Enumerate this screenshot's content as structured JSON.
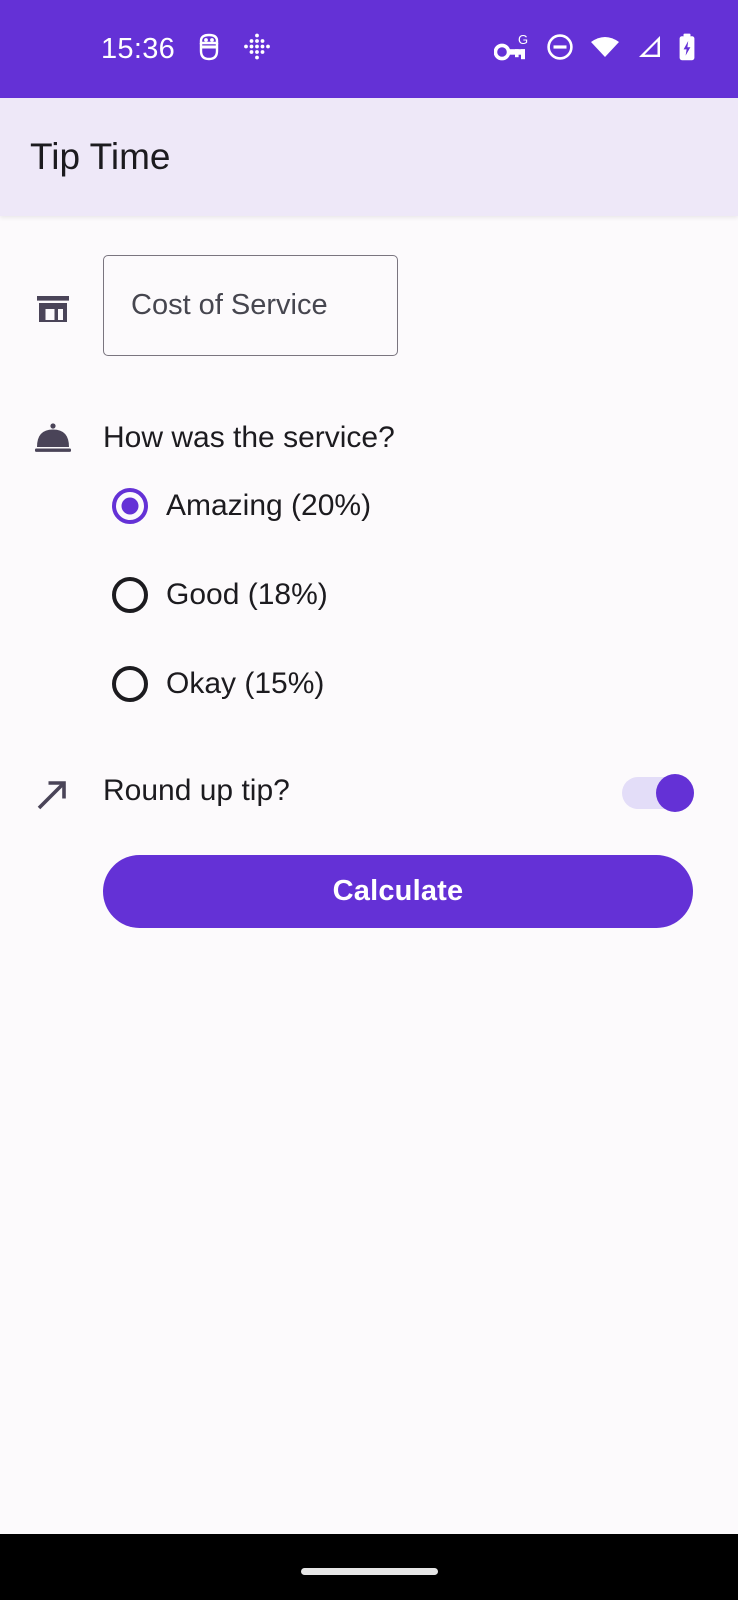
{
  "status_bar": {
    "clock": "15:36",
    "background_color": "#6431D6",
    "left_icons": [
      {
        "name": "android-debug-icon",
        "label": "USB debugging"
      },
      {
        "name": "dotted-diamond-icon",
        "label": "Developer indicator"
      }
    ],
    "right_icons": [
      {
        "name": "vpn-key-g-icon",
        "label": "VPN key"
      },
      {
        "name": "do-not-disturb-icon",
        "label": "Do not disturb"
      },
      {
        "name": "wifi-icon",
        "label": "Wi-Fi full"
      },
      {
        "name": "cellular-signal-icon",
        "label": "Mobile signal"
      },
      {
        "name": "battery-charging-icon",
        "label": "Battery charging"
      }
    ]
  },
  "app_bar": {
    "title": "Tip Time",
    "background_color": "#EEE8F8"
  },
  "form": {
    "cost_field": {
      "icon": "storefront-icon",
      "placeholder": "Cost of Service",
      "value": ""
    },
    "service_question": {
      "icon": "room-service-dome-icon",
      "label": "How was the service?"
    },
    "tip_options": [
      {
        "label": "Amazing (20%)",
        "percent": "20%",
        "selected": true
      },
      {
        "label": "Good (18%)",
        "percent": "18%",
        "selected": false
      },
      {
        "label": "Okay (15%)",
        "percent": "15%",
        "selected": false
      }
    ],
    "round_up": {
      "icon": "arrow-up-right-icon",
      "label": "Round up tip?",
      "switch_state": "on"
    },
    "calculate_button": {
      "label": "Calculate",
      "background_color": "#6431D6",
      "text_color": "#FFFFFF"
    }
  },
  "nav_bar": {
    "gesture_pill": "",
    "background_color": "#000000"
  },
  "theme": {
    "primary": "#6431D6",
    "surface": "#FCFAFC",
    "app_bar_surface": "#EEE8F8",
    "on_surface": "#1C1B1F",
    "outline": "#7A757F",
    "switch_track": "#E3DDF8"
  }
}
